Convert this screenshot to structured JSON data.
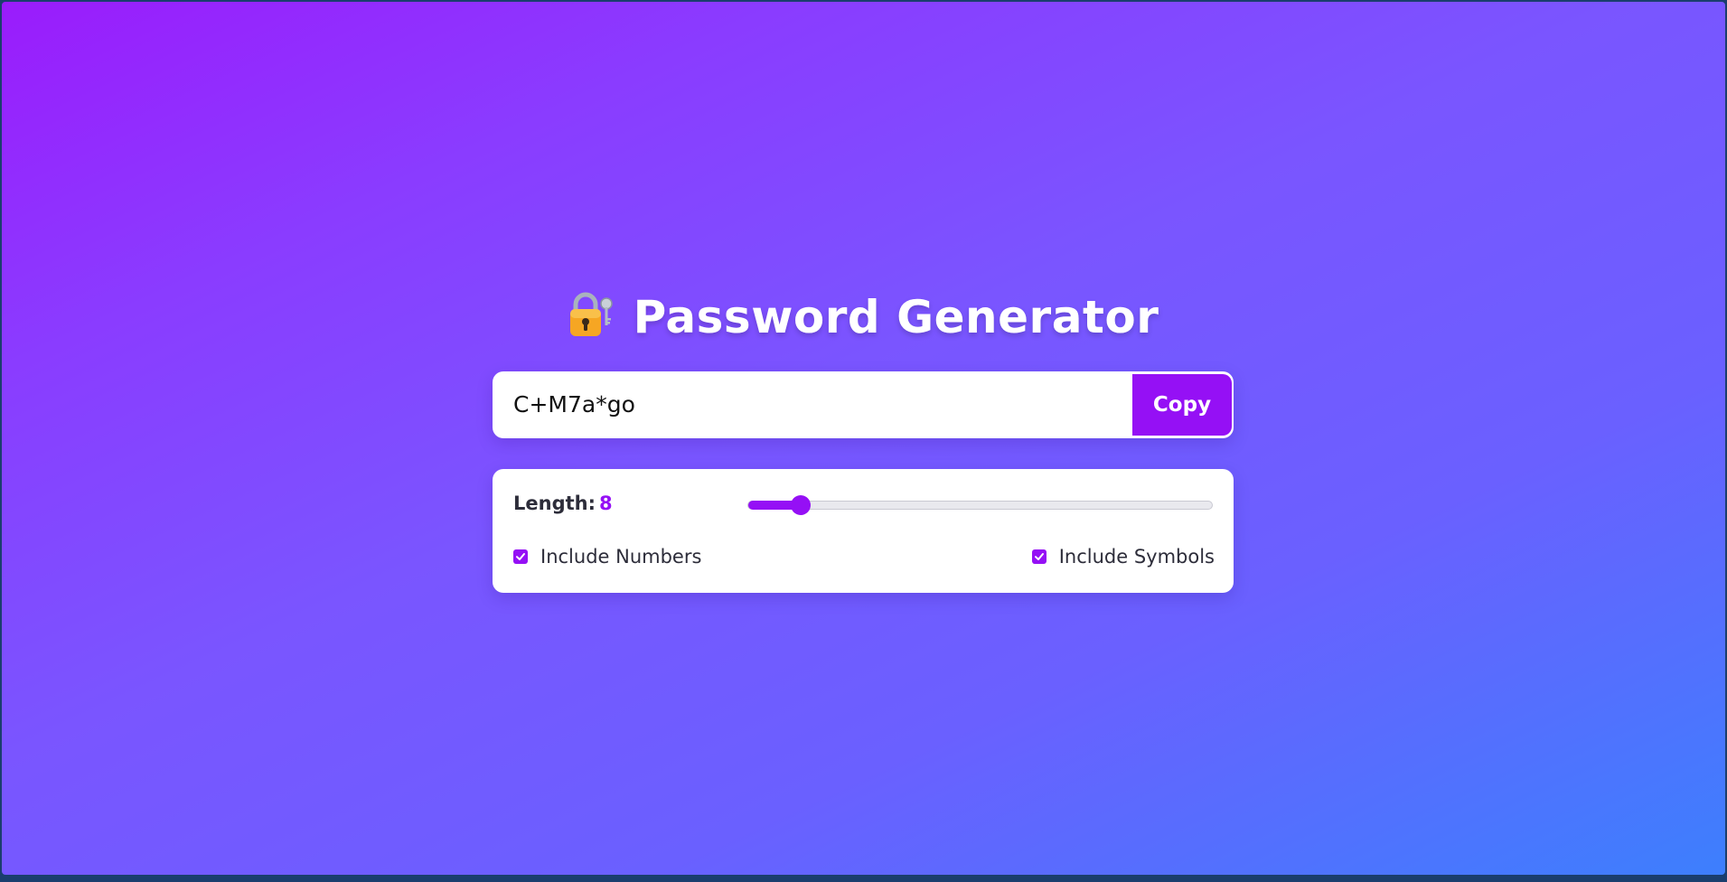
{
  "app": {
    "title": "Password Generator",
    "title_icon": "lock-with-key-icon"
  },
  "password": {
    "value": "C+M7a*go",
    "copy_label": "Copy"
  },
  "options": {
    "length_label": "Length:",
    "length_value": "8",
    "length_slider": {
      "value": 8,
      "min": 4,
      "max": 64
    },
    "include_numbers": {
      "label": "Include Numbers",
      "checked": true
    },
    "include_symbols": {
      "label": "Include Symbols",
      "checked": true
    }
  },
  "colors": {
    "accent": "#9510f5",
    "background_start": "#9a1cfc",
    "background_end": "#3d7ffd"
  }
}
